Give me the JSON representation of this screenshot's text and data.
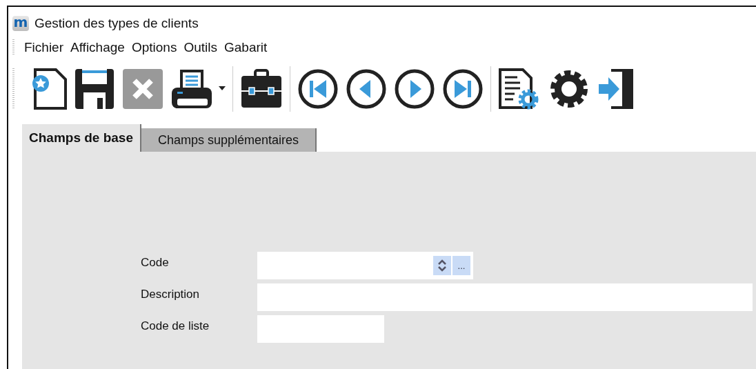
{
  "window": {
    "title": "Gestion des types de clients",
    "app_letter": "m"
  },
  "menu": [
    "Fichier",
    "Affichage",
    "Options",
    "Outils",
    "Gabarit"
  ],
  "tabs": [
    {
      "label": "Champs de base",
      "selected": true
    },
    {
      "label": "Champs supplémentaires",
      "selected": false
    }
  ],
  "fields": [
    {
      "label": "Code",
      "kind": "spin",
      "browse": "..."
    },
    {
      "label": "Description",
      "kind": "wide"
    },
    {
      "label": "Code de liste",
      "kind": "short"
    }
  ]
}
